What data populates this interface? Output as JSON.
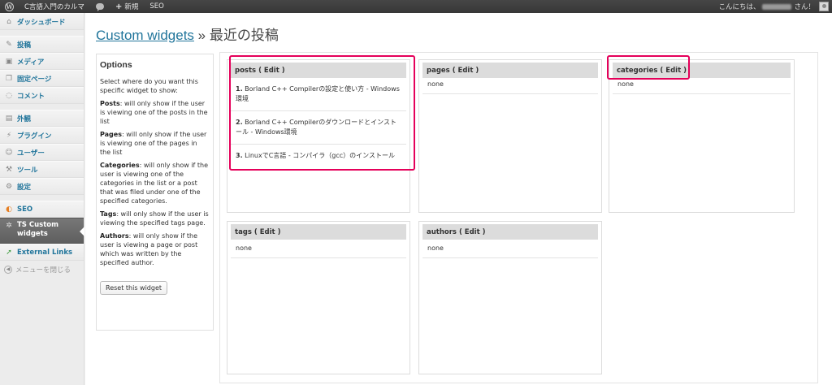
{
  "adminbar": {
    "site_name": "C言語入門のカルマ",
    "new_label": "新規",
    "seo_label": "SEO",
    "greeting_prefix": "こんにちは、",
    "greeting_suffix": "さん！"
  },
  "sidebar": {
    "items": [
      {
        "label": "ダッシュボード",
        "icon": "dashboard-icon"
      },
      {
        "label": "投稿",
        "icon": "posts-icon"
      },
      {
        "label": "メディア",
        "icon": "media-icon"
      },
      {
        "label": "固定ページ",
        "icon": "pages-icon"
      },
      {
        "label": "コメント",
        "icon": "comments-icon"
      },
      {
        "label": "外観",
        "icon": "appearance-icon"
      },
      {
        "label": "プラグイン",
        "icon": "plugins-icon"
      },
      {
        "label": "ユーザー",
        "icon": "users-icon"
      },
      {
        "label": "ツール",
        "icon": "tools-icon"
      },
      {
        "label": "設定",
        "icon": "settings-icon"
      },
      {
        "label": "SEO",
        "icon": "seo-icon"
      },
      {
        "label": "TS Custom widgets",
        "icon": "ts-custom-widgets-icon"
      },
      {
        "label": "External Links",
        "icon": "external-links-icon"
      }
    ],
    "collapse_label": "メニューを閉じる"
  },
  "page": {
    "title_link": "Custom widgets",
    "title_separator": "»",
    "title_rest": "最近の投稿"
  },
  "options": {
    "heading": "Options",
    "intro": "Select where do you want this specific widget to show:",
    "posts_term": "Posts",
    "posts_desc": ": will only show if the user is viewing one of the posts in the list",
    "pages_term": "Pages",
    "pages_desc": ": will only show if the user is viewing one of the pages in the list",
    "categories_term": "Categories",
    "categories_desc": ": will only show if the user is viewing one of the categories in the list or a post that was filed under one of the specified categories.",
    "tags_term": "Tags",
    "tags_desc": ": will only show if the user is viewing the specified tags page.",
    "authors_term": "Authors",
    "authors_desc": ": will only show if the user is viewing a page or post which was written by the specified author.",
    "reset_label": "Reset this widget"
  },
  "boxes": {
    "posts": {
      "header": "posts ( Edit )",
      "rows": [
        {
          "num": "1.",
          "text": "Borland C++ Compilerの設定と使い方 - Windows環境"
        },
        {
          "num": "2.",
          "text": "Borland C++ Compilerのダウンロードとインストール - Windows環境"
        },
        {
          "num": "3.",
          "text": "LinuxでC言語 - コンパイラ（gcc）のインストール"
        }
      ]
    },
    "pages": {
      "header": "pages ( Edit )",
      "value": "none"
    },
    "categories": {
      "header": "categories ( Edit )",
      "value": "none"
    },
    "tags": {
      "header": "tags ( Edit )",
      "value": "none"
    },
    "authors": {
      "header": "authors ( Edit )",
      "value": "none"
    }
  },
  "colors": {
    "highlight": "#e5005a",
    "link": "#21759b",
    "adminbar": "#464646",
    "current_menu": "#6d6d6d"
  }
}
